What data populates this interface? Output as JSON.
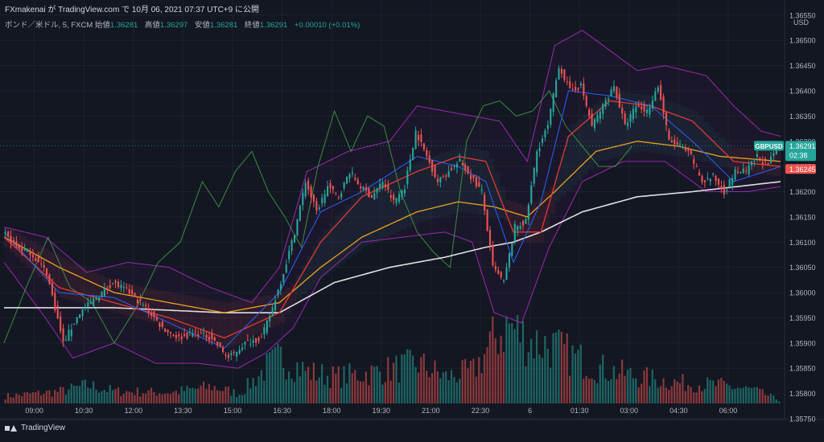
{
  "header": {
    "publisher_line": "FXmakenai が TradingView.com で 10月 06, 2021 07:37 UTC+9 に公開",
    "symbol_line": "ポンド／米ドル, 5, FXCM",
    "open_label": "始値",
    "open_value": "1.36281",
    "high_label": "高値",
    "high_value": "1.36297",
    "low_label": "安値",
    "low_value": "1.36281",
    "close_label": "終値",
    "close_value": "1.36291",
    "change": "+0.00010 (+0.01%)"
  },
  "price_axis": {
    "currency": "USD",
    "ticks": [
      "1.36550",
      "1.36500",
      "1.36450",
      "1.36400",
      "1.36350",
      "1.36300",
      "1.36250",
      "1.36200",
      "1.36150",
      "1.36100",
      "1.36050",
      "1.36000",
      "1.35950",
      "1.35900",
      "1.35850",
      "1.35800",
      "1.35750"
    ],
    "current_symbol": "GBPUSD",
    "current_price": "1.36291",
    "countdown": "02:38",
    "red_line_price": "1.36245"
  },
  "time_axis": {
    "ticks": [
      "09:00",
      "10:30",
      "12:00",
      "13:30",
      "15:00",
      "16:30",
      "18:00",
      "19:30",
      "21:00",
      "22:30",
      "6",
      "01:30",
      "03:00",
      "04:30",
      "06:00"
    ]
  },
  "footer": {
    "brand": "TradingView"
  },
  "colors": {
    "background": "#131722",
    "up": "#26a69a",
    "down": "#ef5350",
    "bollinger": "#9c27b0",
    "ma_slow": "#e0e0e0",
    "ma_orange": "#f0a020",
    "ma_red": "#e53935",
    "ma_blue": "#2962ff",
    "chikou": "#43a047"
  },
  "chart_data": {
    "type": "candlestick",
    "symbol": "GBPUSD",
    "timeframe": "5",
    "y_range": [
      1.3575,
      1.3658
    ],
    "x_range": [
      0,
      282
    ],
    "x_tick_positions": [
      11,
      29,
      47,
      65,
      83,
      101,
      119,
      137,
      155,
      173,
      191,
      209,
      227,
      245,
      263
    ],
    "close_anchors": [
      [
        0,
        1.3612
      ],
      [
        5,
        1.3609
      ],
      [
        10,
        1.3608
      ],
      [
        16,
        1.3604
      ],
      [
        22,
        1.359
      ],
      [
        28,
        1.3596
      ],
      [
        34,
        1.3599
      ],
      [
        40,
        1.3602
      ],
      [
        46,
        1.36
      ],
      [
        52,
        1.3597
      ],
      [
        58,
        1.3593
      ],
      [
        64,
        1.3591
      ],
      [
        70,
        1.3592
      ],
      [
        76,
        1.3591
      ],
      [
        82,
        1.3587
      ],
      [
        88,
        1.359
      ],
      [
        94,
        1.3591
      ],
      [
        98,
        1.3597
      ],
      [
        102,
        1.3604
      ],
      [
        106,
        1.3612
      ],
      [
        110,
        1.3622
      ],
      [
        114,
        1.3616
      ],
      [
        118,
        1.3621
      ],
      [
        122,
        1.3619
      ],
      [
        126,
        1.3624
      ],
      [
        130,
        1.3621
      ],
      [
        134,
        1.3619
      ],
      [
        138,
        1.3622
      ],
      [
        142,
        1.3618
      ],
      [
        146,
        1.3621
      ],
      [
        150,
        1.3632
      ],
      [
        154,
        1.3627
      ],
      [
        158,
        1.3622
      ],
      [
        162,
        1.3624
      ],
      [
        166,
        1.3626
      ],
      [
        170,
        1.3623
      ],
      [
        174,
        1.362
      ],
      [
        178,
        1.3605
      ],
      [
        182,
        1.3602
      ],
      [
        186,
        1.3613
      ],
      [
        190,
        1.3614
      ],
      [
        194,
        1.3628
      ],
      [
        198,
        1.3633
      ],
      [
        202,
        1.3645
      ],
      [
        206,
        1.364
      ],
      [
        210,
        1.3641
      ],
      [
        214,
        1.3633
      ],
      [
        218,
        1.3637
      ],
      [
        222,
        1.3641
      ],
      [
        226,
        1.3633
      ],
      [
        230,
        1.3637
      ],
      [
        234,
        1.3636
      ],
      [
        238,
        1.3641
      ],
      [
        242,
        1.363
      ],
      [
        246,
        1.3629
      ],
      [
        250,
        1.3627
      ],
      [
        254,
        1.3622
      ],
      [
        258,
        1.3623
      ],
      [
        262,
        1.362
      ],
      [
        266,
        1.3624
      ],
      [
        270,
        1.3624
      ],
      [
        274,
        1.3627
      ],
      [
        278,
        1.3625
      ],
      [
        281,
        1.36291
      ]
    ],
    "ma_slow_anchors": [
      [
        0,
        1.3597
      ],
      [
        40,
        1.3597
      ],
      [
        80,
        1.3596
      ],
      [
        100,
        1.3596
      ],
      [
        120,
        1.3602
      ],
      [
        140,
        1.3605
      ],
      [
        160,
        1.3607
      ],
      [
        175,
        1.3609
      ],
      [
        185,
        1.361
      ],
      [
        195,
        1.3612
      ],
      [
        210,
        1.3616
      ],
      [
        230,
        1.3619
      ],
      [
        250,
        1.362
      ],
      [
        282,
        1.3622
      ]
    ],
    "ma_orange_anchors": [
      [
        0,
        1.3611
      ],
      [
        20,
        1.3605
      ],
      [
        40,
        1.36
      ],
      [
        60,
        1.3598
      ],
      [
        80,
        1.3596
      ],
      [
        100,
        1.3598
      ],
      [
        115,
        1.3605
      ],
      [
        130,
        1.3611
      ],
      [
        150,
        1.3616
      ],
      [
        165,
        1.3618
      ],
      [
        178,
        1.3617
      ],
      [
        190,
        1.3615
      ],
      [
        200,
        1.362
      ],
      [
        215,
        1.3628
      ],
      [
        230,
        1.363
      ],
      [
        245,
        1.3629
      ],
      [
        260,
        1.3627
      ],
      [
        282,
        1.3626
      ]
    ],
    "ma_red_anchors": [
      [
        0,
        1.3611
      ],
      [
        20,
        1.3601
      ],
      [
        40,
        1.3598
      ],
      [
        60,
        1.3595
      ],
      [
        80,
        1.3591
      ],
      [
        100,
        1.3596
      ],
      [
        115,
        1.361
      ],
      [
        130,
        1.3619
      ],
      [
        150,
        1.3624
      ],
      [
        165,
        1.3627
      ],
      [
        175,
        1.3626
      ],
      [
        185,
        1.3612
      ],
      [
        195,
        1.3612
      ],
      [
        205,
        1.3631
      ],
      [
        220,
        1.3638
      ],
      [
        235,
        1.3637
      ],
      [
        250,
        1.3634
      ],
      [
        265,
        1.3626
      ],
      [
        282,
        1.3625
      ]
    ],
    "ma_blue_anchors": [
      [
        0,
        1.3612
      ],
      [
        20,
        1.36
      ],
      [
        40,
        1.3599
      ],
      [
        60,
        1.3594
      ],
      [
        80,
        1.3589
      ],
      [
        100,
        1.36
      ],
      [
        115,
        1.3616
      ],
      [
        130,
        1.362
      ],
      [
        150,
        1.3627
      ],
      [
        165,
        1.3625
      ],
      [
        175,
        1.3622
      ],
      [
        185,
        1.3606
      ],
      [
        195,
        1.3618
      ],
      [
        205,
        1.364
      ],
      [
        220,
        1.3639
      ],
      [
        235,
        1.3637
      ],
      [
        250,
        1.363
      ],
      [
        265,
        1.3622
      ],
      [
        282,
        1.3625
      ]
    ],
    "bb_upper_anchors": [
      [
        0,
        1.3613
      ],
      [
        15,
        1.3611
      ],
      [
        30,
        1.3604
      ],
      [
        45,
        1.3606
      ],
      [
        60,
        1.3605
      ],
      [
        75,
        1.3601
      ],
      [
        90,
        1.3598
      ],
      [
        100,
        1.3605
      ],
      [
        110,
        1.3624
      ],
      [
        125,
        1.3628
      ],
      [
        140,
        1.363
      ],
      [
        150,
        1.3637
      ],
      [
        160,
        1.3636
      ],
      [
        170,
        1.3635
      ],
      [
        180,
        1.3634
      ],
      [
        190,
        1.3626
      ],
      [
        200,
        1.3649
      ],
      [
        210,
        1.3652
      ],
      [
        220,
        1.3648
      ],
      [
        230,
        1.3644
      ],
      [
        240,
        1.3645
      ],
      [
        255,
        1.3643
      ],
      [
        265,
        1.3637
      ],
      [
        275,
        1.3632
      ],
      [
        282,
        1.3631
      ]
    ],
    "bb_lower_anchors": [
      [
        0,
        1.3606
      ],
      [
        15,
        1.3595
      ],
      [
        25,
        1.3587
      ],
      [
        40,
        1.359
      ],
      [
        55,
        1.3586
      ],
      [
        70,
        1.3586
      ],
      [
        85,
        1.3585
      ],
      [
        95,
        1.3588
      ],
      [
        105,
        1.3593
      ],
      [
        115,
        1.3603
      ],
      [
        130,
        1.361
      ],
      [
        145,
        1.3611
      ],
      [
        160,
        1.3612
      ],
      [
        170,
        1.361
      ],
      [
        178,
        1.3596
      ],
      [
        188,
        1.3594
      ],
      [
        198,
        1.3609
      ],
      [
        210,
        1.3622
      ],
      [
        225,
        1.3626
      ],
      [
        240,
        1.3626
      ],
      [
        255,
        1.362
      ],
      [
        270,
        1.362
      ],
      [
        282,
        1.3621
      ]
    ],
    "chikou_anchors": [
      [
        0,
        1.359
      ],
      [
        8,
        1.3601
      ],
      [
        16,
        1.3611
      ],
      [
        24,
        1.3601
      ],
      [
        32,
        1.3598
      ],
      [
        40,
        1.359
      ],
      [
        48,
        1.3597
      ],
      [
        56,
        1.3606
      ],
      [
        64,
        1.361
      ],
      [
        72,
        1.3622
      ],
      [
        78,
        1.3617
      ],
      [
        84,
        1.3624
      ],
      [
        90,
        1.3628
      ],
      [
        96,
        1.362
      ],
      [
        102,
        1.3615
      ],
      [
        108,
        1.3609
      ],
      [
        114,
        1.3625
      ],
      [
        120,
        1.3636
      ],
      [
        126,
        1.3628
      ],
      [
        132,
        1.3635
      ],
      [
        138,
        1.3633
      ],
      [
        144,
        1.362
      ],
      [
        150,
        1.3612
      ],
      [
        156,
        1.3608
      ],
      [
        162,
        1.3605
      ],
      [
        168,
        1.363
      ],
      [
        174,
        1.3637
      ],
      [
        180,
        1.3638
      ],
      [
        186,
        1.3635
      ],
      [
        192,
        1.3636
      ],
      [
        198,
        1.364
      ],
      [
        204,
        1.3633
      ],
      [
        210,
        1.3629
      ],
      [
        216,
        1.3625
      ],
      [
        222,
        1.3625
      ],
      [
        228,
        1.3629
      ]
    ],
    "volume_anchors": [
      [
        0,
        0.06
      ],
      [
        20,
        0.1
      ],
      [
        30,
        0.15
      ],
      [
        40,
        0.1
      ],
      [
        60,
        0.09
      ],
      [
        75,
        0.14
      ],
      [
        85,
        0.08
      ],
      [
        95,
        0.3
      ],
      [
        100,
        0.38
      ],
      [
        110,
        0.26
      ],
      [
        120,
        0.22
      ],
      [
        135,
        0.26
      ],
      [
        150,
        0.33
      ],
      [
        160,
        0.22
      ],
      [
        170,
        0.27
      ],
      [
        178,
        0.55
      ],
      [
        183,
        0.65
      ],
      [
        190,
        0.52
      ],
      [
        198,
        0.48
      ],
      [
        205,
        0.4
      ],
      [
        215,
        0.3
      ],
      [
        230,
        0.22
      ],
      [
        245,
        0.17
      ],
      [
        260,
        0.15
      ],
      [
        272,
        0.11
      ],
      [
        282,
        0.02
      ]
    ]
  }
}
